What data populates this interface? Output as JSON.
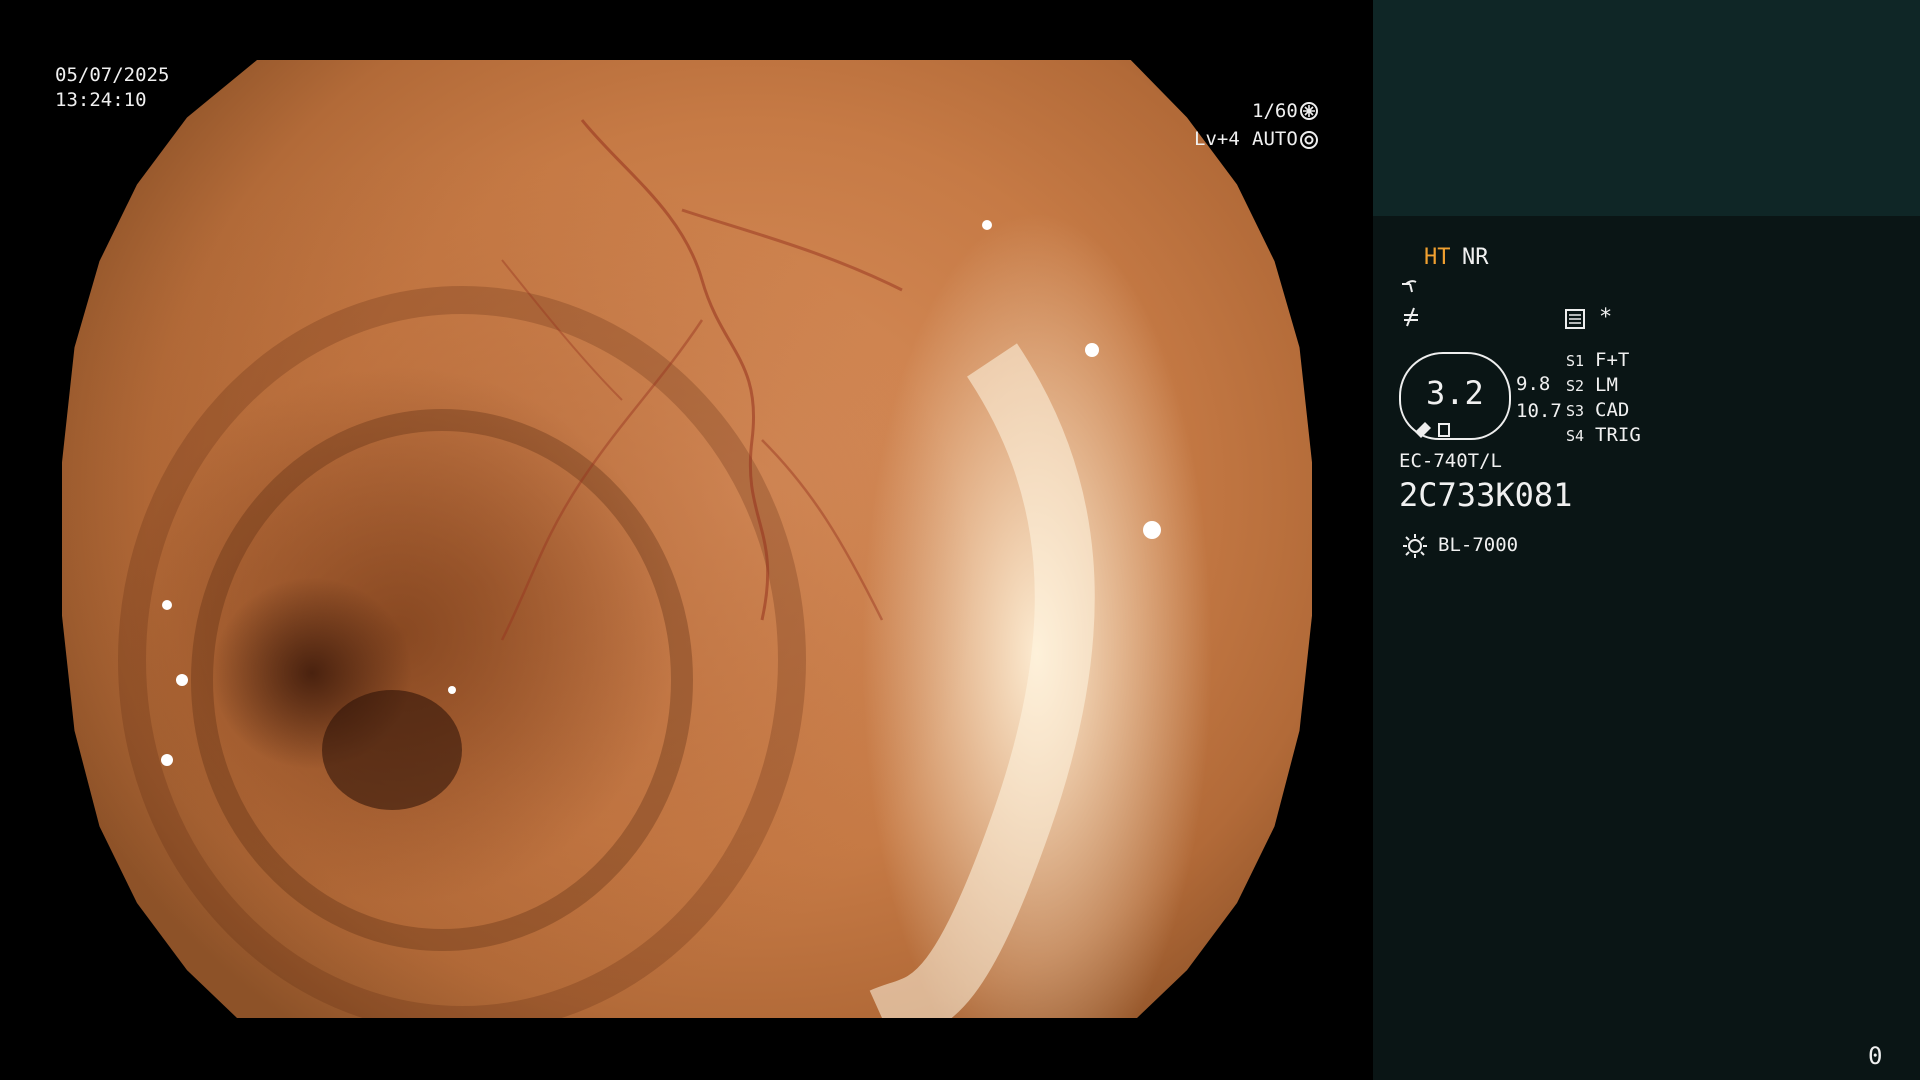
{
  "overlay": {
    "date": "05/07/2025",
    "time": "13:24:10",
    "shutter": "1/60",
    "level": "Lv+4",
    "iris_mode": "AUTO"
  },
  "sidebar": {
    "mode_ht": "HT",
    "mode_nr": "NR",
    "star": "*",
    "zoom_value": "3.2",
    "zoom_side_1": "9.8",
    "zoom_side_2": "10.7",
    "switches": [
      {
        "key": "S1",
        "value": "F+T"
      },
      {
        "key": "S2",
        "value": "LM"
      },
      {
        "key": "S3",
        "value": "CAD"
      },
      {
        "key": "S4",
        "value": "TRIG"
      }
    ],
    "scope_model": "EC-740T/L",
    "serial": "2C733K081",
    "light_source": "BL-7000",
    "counter": "0"
  },
  "icons": [
    "shutter-icon",
    "auto-iris-icon",
    "enhancement-icon",
    "color-tone-icon",
    "record-icon",
    "light-icon"
  ],
  "colors": {
    "background": "#000000",
    "sidebar": "#0a1515",
    "sidebar_header": "#0f2626",
    "highlight": "#f0a030",
    "text": "#f0f0f0"
  }
}
